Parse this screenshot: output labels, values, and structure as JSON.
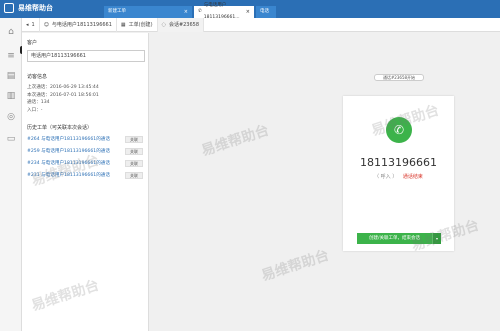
{
  "app": {
    "title": "易维帮助台"
  },
  "top_tabs": [
    {
      "label": "新建工单"
    },
    {
      "label": "与电话用户18113196661..."
    },
    {
      "label": "电话"
    }
  ],
  "tooltip": "客服界面首页",
  "subtabs": [
    {
      "label": "1"
    },
    {
      "label": "与电话用户18113196661"
    },
    {
      "label": "工单(创建)"
    },
    {
      "label": "会话#23658"
    }
  ],
  "customer": {
    "section": "客户",
    "name_value": "电话用户18113196661"
  },
  "visit_info": {
    "section": "访客信息",
    "lines": [
      "上次通话：2016-06-29 13:45:44",
      "本次通话：2016-07-01 18:56:01",
      "通话：134",
      "入口：-"
    ]
  },
  "history": {
    "section": "历史工单（可关联本次会话）",
    "items": [
      {
        "text": "#264 与电话用户18113196661的通话",
        "button": "关联"
      },
      {
        "text": "#259 与电话用户18113196661的通话",
        "button": "关联"
      },
      {
        "text": "#234 与电话用户18113196661的通话",
        "button": "关联"
      },
      {
        "text": "#231 与电话用户18113196661的通话",
        "button": "关联"
      }
    ]
  },
  "call": {
    "start_badge": "通话#23658开始",
    "number": "18113196661",
    "direction": "（ 呼入 ）",
    "status": "通话结束",
    "action_label": "创建/关联工单，结束会话",
    "action_caret": "▾"
  },
  "watermark": "易维帮助台",
  "colors": {
    "brand": "#2b6fb5",
    "call_green": "#3cb34a",
    "status_red": "#d9362b"
  }
}
